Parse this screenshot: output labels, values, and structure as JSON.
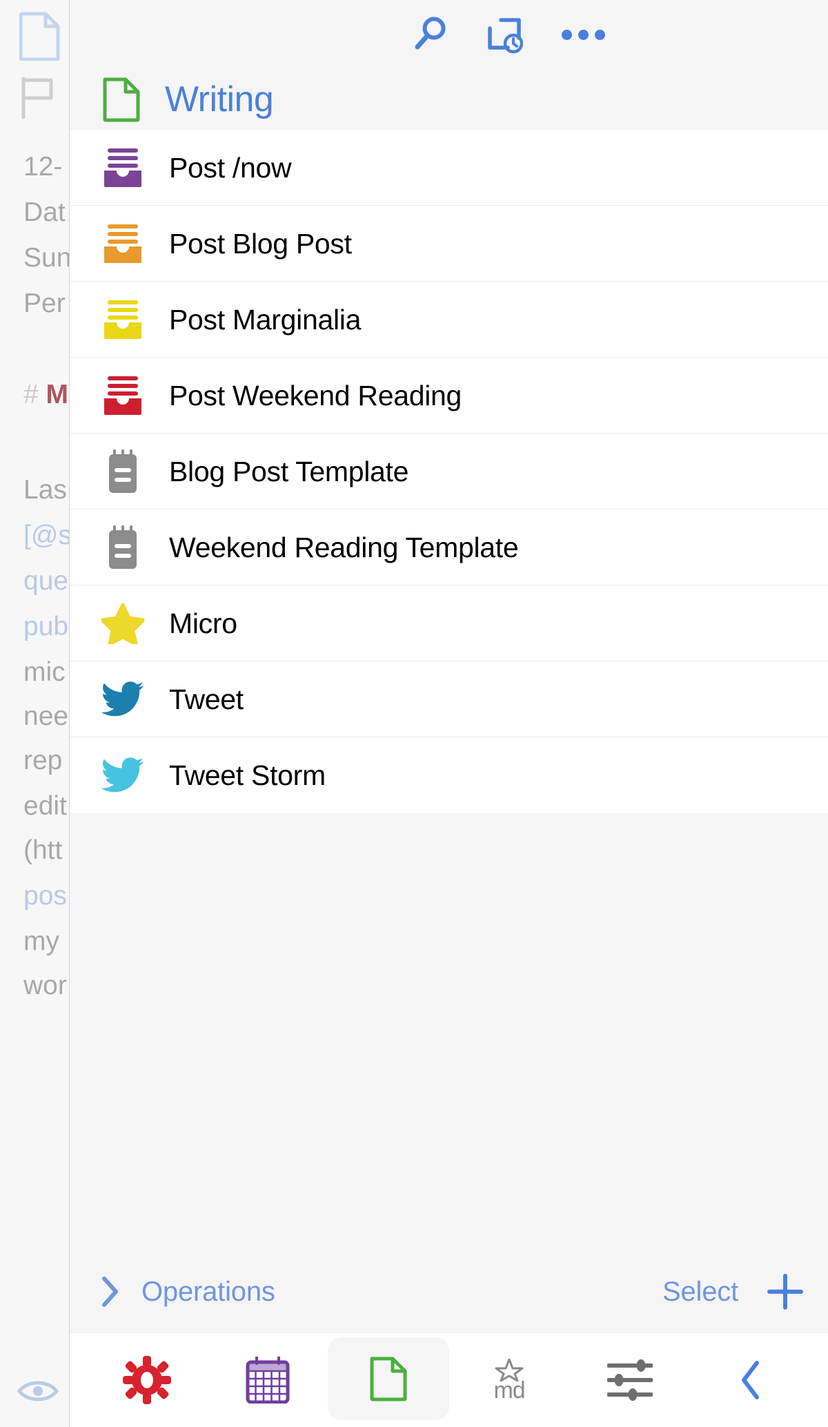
{
  "app": {
    "background_color": "#f7f7f7",
    "accent_color": "#4a80dd",
    "panel_background": "#ffffff"
  },
  "editor": {
    "icons": [
      {
        "name": "document-icon",
        "color": "#c3d5ef"
      },
      {
        "name": "flag-icon",
        "color": "#cfcfcf"
      },
      {
        "name": "eye-icon",
        "color": "#b9cbe6"
      }
    ],
    "lines": [
      {
        "text": "12-",
        "style": "plain"
      },
      {
        "text": "Dat",
        "style": "plain"
      },
      {
        "text": "Sun",
        "style": "plain"
      },
      {
        "text": "Per",
        "style": "plain"
      },
      {
        "text": "# M",
        "style": "heading"
      },
      {
        "text": "Las",
        "style": "plain"
      },
      {
        "text": "[@s",
        "style": "link"
      },
      {
        "text": "que",
        "style": "link"
      },
      {
        "text": "pub",
        "style": "link"
      },
      {
        "text": "mic",
        "style": "plain"
      },
      {
        "text": "nee",
        "style": "plain"
      },
      {
        "text": "rep",
        "style": "plain"
      },
      {
        "text": "edit",
        "style": "plain"
      },
      {
        "text": "(htt",
        "style": "plain"
      },
      {
        "text": "pos",
        "style": "link"
      },
      {
        "text": "my",
        "style": "plain"
      },
      {
        "text": "wor",
        "style": "plain"
      }
    ]
  },
  "toolbar": {
    "search_icon": "search-icon",
    "recent_icon": "recent-history-icon",
    "more_icon": "more-options-icon"
  },
  "workspace": {
    "icon": "document-outline-icon",
    "icon_color": "#4caf3e",
    "title": "Writing",
    "title_color": "#4a80dd"
  },
  "actions": [
    {
      "label": "Post /now",
      "icon": "archive-inbox-icon",
      "color": "#7b4397"
    },
    {
      "label": "Post Blog Post",
      "icon": "archive-inbox-icon",
      "color": "#e89a2c"
    },
    {
      "label": "Post Marginalia",
      "icon": "archive-inbox-icon",
      "color": "#ead716"
    },
    {
      "label": "Post Weekend Reading",
      "icon": "archive-inbox-icon",
      "color": "#cc2030"
    },
    {
      "label": "Blog Post Template",
      "icon": "notepad-icon",
      "color": "#8c8c8c"
    },
    {
      "label": "Weekend Reading Template",
      "icon": "notepad-icon",
      "color": "#8c8c8c"
    },
    {
      "label": "Micro",
      "icon": "star-icon",
      "color": "#edd92c"
    },
    {
      "label": "Tweet",
      "icon": "twitter-bird-icon",
      "color": "#1d7fad"
    },
    {
      "label": "Tweet Storm",
      "icon": "twitter-bird-icon",
      "color": "#46c3e0"
    }
  ],
  "footer": {
    "operations_label": "Operations",
    "operations_chevron": "chevron-right-icon",
    "select_label": "Select",
    "add_icon": "plus-icon",
    "link_color": "#6f96e0"
  },
  "tab_bar": {
    "items": [
      {
        "name": "tab-settings",
        "icon": "gear-icon",
        "color": "#d8222d",
        "active": false
      },
      {
        "name": "tab-calendar",
        "icon": "calendar-icon",
        "color": "#6f3f9e",
        "active": false
      },
      {
        "name": "tab-drafts",
        "icon": "document-outline-icon",
        "color": "#4caf3e",
        "active": true
      },
      {
        "name": "tab-markdown",
        "icon": "markdown-star-icon",
        "color": "#8a8a8a",
        "active": false,
        "text": "md"
      },
      {
        "name": "tab-sliders",
        "icon": "sliders-icon",
        "color": "#6e6e6e",
        "active": false
      },
      {
        "name": "tab-back",
        "icon": "chevron-left-icon",
        "color": "#4a80dd",
        "active": false
      }
    ]
  }
}
